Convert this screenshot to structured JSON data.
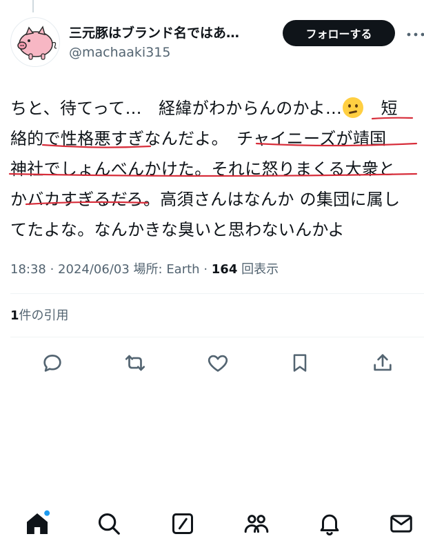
{
  "author": {
    "display_name": "三元豚はブランド名ではあ…",
    "handle": "@machaaki315",
    "avatar_icon": "pig-avatar-icon"
  },
  "follow_label": "フォローする",
  "tweet": {
    "lines": [
      {
        "text_before": "ちと、待てって…　経緯がわからんのかよ…",
        "emoji": "thinking-face",
        "text_after": "　短"
      },
      {
        "text": "絡的で性格悪すぎなんだよ。　チャイニーズが靖国"
      },
      {
        "text": "神社でしょんべんかけた。それに怒りまくる大衆と"
      },
      {
        "text": "かバカすぎるだろ。高須さんはなんか の集団に属し"
      },
      {
        "text": "てたよな。なんかきな臭いと思わないんかよ"
      }
    ],
    "underline_color": "#d72d3a"
  },
  "meta": {
    "time": "18:38",
    "sep1": " · ",
    "date": "2024/06/03",
    "location_label": " 場所: ",
    "location": "Earth",
    "sep2": " · ",
    "views": "164",
    "views_label": " 回表示"
  },
  "quotes": {
    "count": "1",
    "label": "件の引用"
  },
  "actions": [
    "reply-icon",
    "retweet-icon",
    "like-icon",
    "bookmark-icon",
    "share-icon"
  ],
  "nav": [
    "home-icon",
    "search-icon",
    "compose-icon",
    "communities-icon",
    "notifications-icon",
    "messages-icon"
  ],
  "colors": {
    "text": "#0f1419",
    "secondary": "#536471",
    "accent_dot": "#1d9bf0",
    "follow_bg": "#0f1419"
  }
}
